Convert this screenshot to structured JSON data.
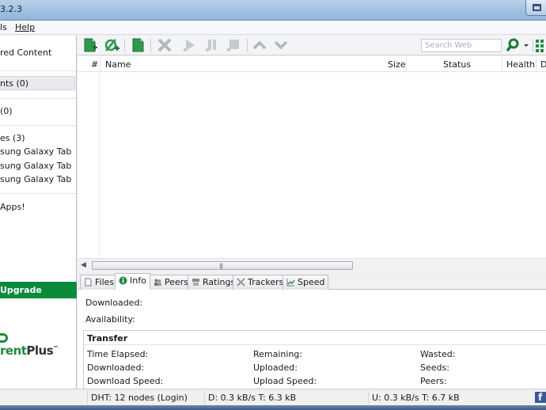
{
  "window": {
    "title": "3.2.3",
    "ghost_title": ""
  },
  "menu": [
    "ls",
    "Help"
  ],
  "sidebar": {
    "items": [
      {
        "label": "red Content"
      },
      {
        "label": "nts (0)"
      },
      {
        "label": "(0)"
      },
      {
        "label": "es (3)"
      },
      {
        "label": "sung Galaxy Tab"
      },
      {
        "label": "sung Galaxy Tab"
      },
      {
        "label": "sung Galaxy Tab"
      },
      {
        "label": "Apps!"
      }
    ],
    "upgrade_label": "Upgrade",
    "logo_text_green": "rent",
    "logo_text_dark": "Plus",
    "logo_tm": "™"
  },
  "toolbar": {
    "icons": [
      "add-torrent-icon",
      "add-url-icon",
      "create-torrent-icon",
      "remove-icon",
      "start-icon",
      "pause-icon",
      "stop-icon",
      "move-up-icon",
      "move-down-icon"
    ],
    "search_placeholder": "Search Web",
    "search_icon": "magnifier-icon",
    "view_icon": "grid-view-icon"
  },
  "file_list": {
    "columns": [
      "#",
      "Name",
      "Size",
      "Status",
      "Health",
      "D"
    ],
    "rows": []
  },
  "tabs": [
    {
      "label": "Files",
      "icon": "files-icon"
    },
    {
      "label": "Info",
      "icon": "info-icon"
    },
    {
      "label": "Peers",
      "icon": "peers-icon"
    },
    {
      "label": "Ratings",
      "icon": "ratings-icon"
    },
    {
      "label": "Trackers",
      "icon": "trackers-icon"
    },
    {
      "label": "Speed",
      "icon": "speed-icon"
    }
  ],
  "info": {
    "downloaded_label": "Downloaded:",
    "availability_label": "Availability:",
    "transfer": {
      "heading": "Transfer",
      "col1": [
        "Time Elapsed:",
        "Downloaded:",
        "Download Speed:"
      ],
      "col2": [
        "Remaining:",
        "Uploaded:",
        "Upload Speed:"
      ],
      "col3": [
        "Wasted:",
        "Seeds:",
        "Peers:"
      ]
    }
  },
  "status": {
    "dht": "DHT: 12 nodes (Login)",
    "download": "D: 0.3 kB/s T: 6.3 kB",
    "upload": "U: 0.3 kB/s T: 6.7 kB",
    "facebook_icon": "f"
  },
  "colors": {
    "accent_green": "#0b8a3c",
    "toolbar_grey": "#c9cdd2"
  }
}
